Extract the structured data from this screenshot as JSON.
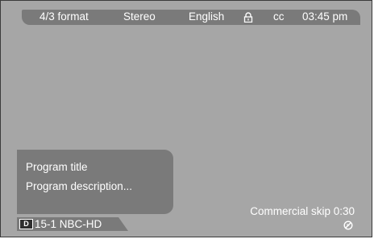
{
  "status_bar": {
    "format": "4/3 format",
    "audio": "Stereo",
    "language": "English",
    "lock_icon": "lock-icon",
    "captions": "cc",
    "time": "03:45 pm"
  },
  "program": {
    "title": "Program title",
    "description": "Program description..."
  },
  "channel": {
    "badge": "D",
    "number_name": "15-1  NBC-HD"
  },
  "commercial_skip": {
    "label": "Commercial skip 0:30",
    "icon": "skip-icon"
  },
  "colors": {
    "screen_bg": "#a6a6a6",
    "bar_bg": "#7a7a7a",
    "text": "#ffffff"
  }
}
